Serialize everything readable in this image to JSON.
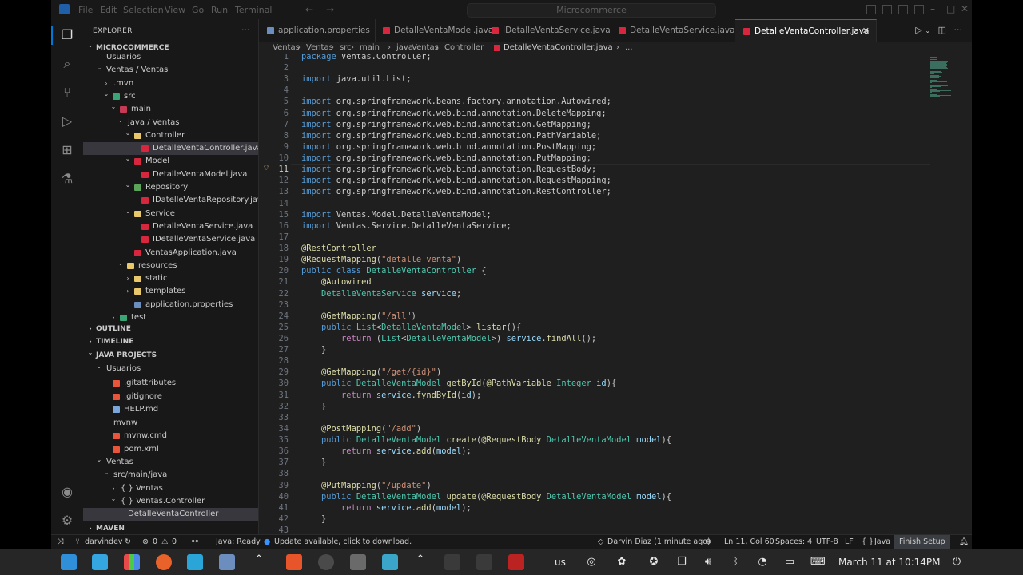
{
  "titlebar": {
    "menu": [
      "File",
      "Edit",
      "Selection",
      "View",
      "Go",
      "Run",
      "Terminal"
    ],
    "command_center": "Microcommerce"
  },
  "sidebar": {
    "title": "EXPLORER",
    "project_header": "MICROCOMMERCE",
    "tree": [
      {
        "label": "Usuarios",
        "indent": 1,
        "twisty": "",
        "icon": ""
      },
      {
        "label": "Ventas / Ventas",
        "indent": 1,
        "twisty": "v",
        "icon": ""
      },
      {
        "label": ".mvn",
        "indent": 2,
        "twisty": ">",
        "icon": ""
      },
      {
        "label": "src",
        "indent": 2,
        "twisty": "v",
        "icon": "#3aa675"
      },
      {
        "label": "main",
        "indent": 3,
        "twisty": "v",
        "icon": "#c73a55"
      },
      {
        "label": "java / Ventas",
        "indent": 4,
        "twisty": "v",
        "icon": ""
      },
      {
        "label": "Controller",
        "indent": 5,
        "twisty": "v",
        "icon": "#e8c86a"
      },
      {
        "label": "DetalleVentaController.java",
        "indent": 6,
        "twisty": "",
        "icon": "#d7263d",
        "selected": true
      },
      {
        "label": "Model",
        "indent": 5,
        "twisty": "v",
        "icon": "#d7263d"
      },
      {
        "label": "DetalleVentaModel.java",
        "indent": 6,
        "twisty": "",
        "icon": "#d7263d"
      },
      {
        "label": "Repository",
        "indent": 5,
        "twisty": "v",
        "icon": "#5aa55a"
      },
      {
        "label": "IDatelleVentaRepository.java",
        "indent": 6,
        "twisty": "",
        "icon": "#d7263d"
      },
      {
        "label": "Service",
        "indent": 5,
        "twisty": "v",
        "icon": "#e8c86a"
      },
      {
        "label": "DetalleVentaService.java",
        "indent": 6,
        "twisty": "",
        "icon": "#d7263d"
      },
      {
        "label": "IDetalleVentaService.java",
        "indent": 6,
        "twisty": "",
        "icon": "#d7263d"
      },
      {
        "label": "VentasApplication.java",
        "indent": 5,
        "twisty": "",
        "icon": "#d7263d"
      },
      {
        "label": "resources",
        "indent": 4,
        "twisty": "v",
        "icon": "#e8c86a"
      },
      {
        "label": "static",
        "indent": 5,
        "twisty": ">",
        "icon": "#e8c86a"
      },
      {
        "label": "templates",
        "indent": 5,
        "twisty": ">",
        "icon": "#e8c86a"
      },
      {
        "label": "application.properties",
        "indent": 5,
        "twisty": "",
        "icon": "#6c8ebf"
      },
      {
        "label": "test",
        "indent": 3,
        "twisty": ">",
        "icon": "#3aa675"
      }
    ],
    "sections": [
      "OUTLINE",
      "TIMELINE",
      "JAVA PROJECTS"
    ],
    "java_projects": [
      {
        "label": "Usuarios",
        "indent": 1,
        "twisty": "v",
        "icon": ""
      },
      {
        "label": ".gitattributes",
        "indent": 2,
        "twisty": "",
        "icon": "#e8553a"
      },
      {
        "label": ".gitignore",
        "indent": 2,
        "twisty": "",
        "icon": "#e8553a"
      },
      {
        "label": "HELP.md",
        "indent": 2,
        "twisty": "",
        "icon": "#7aa6da"
      },
      {
        "label": "mvnw",
        "indent": 2,
        "twisty": "",
        "icon": ""
      },
      {
        "label": "mvnw.cmd",
        "indent": 2,
        "twisty": "",
        "icon": "#e8553a"
      },
      {
        "label": "pom.xml",
        "indent": 2,
        "twisty": "",
        "icon": "#e8553a"
      },
      {
        "label": "Ventas",
        "indent": 1,
        "twisty": "v",
        "icon": ""
      },
      {
        "label": "src/main/java",
        "indent": 2,
        "twisty": "v",
        "icon": ""
      },
      {
        "label": "{ } Ventas",
        "indent": 3,
        "twisty": ">",
        "icon": ""
      },
      {
        "label": "{ } Ventas.Controller",
        "indent": 3,
        "twisty": "v",
        "icon": ""
      },
      {
        "label": "DetalleVentaController",
        "indent": 4,
        "twisty": "",
        "icon": "",
        "selected": true
      }
    ],
    "maven_header": "MAVEN"
  },
  "tabs": [
    {
      "label": "application.properties",
      "icon": "#6c8ebf",
      "active": false
    },
    {
      "label": "DetalleVentaModel.java",
      "icon": "#d7263d",
      "active": false
    },
    {
      "label": "IDetalleVentaService.java",
      "icon": "#d7263d",
      "active": false
    },
    {
      "label": "DetalleVentaService.java",
      "icon": "#d7263d",
      "active": false
    },
    {
      "label": "DetalleVentaController.java",
      "icon": "#d7263d",
      "active": true
    }
  ],
  "breadcrumb": [
    "Ventas",
    "Ventas",
    "src",
    "main",
    "java",
    "Ventas",
    "Controller",
    "DetalleVentaController.java",
    "..."
  ],
  "editor": {
    "current_line": 11,
    "lines": [
      {
        "n": 1,
        "tokens": [
          [
            "k",
            "package "
          ],
          [
            "p",
            "Ventas.Controller;"
          ]
        ]
      },
      {
        "n": 2,
        "tokens": []
      },
      {
        "n": 3,
        "tokens": [
          [
            "k",
            "import "
          ],
          [
            "p",
            "java.util.List;"
          ]
        ]
      },
      {
        "n": 4,
        "tokens": []
      },
      {
        "n": 5,
        "tokens": [
          [
            "k",
            "import "
          ],
          [
            "p",
            "org.springframework.beans.factory.annotation.Autowired;"
          ]
        ]
      },
      {
        "n": 6,
        "tokens": [
          [
            "k",
            "import "
          ],
          [
            "p",
            "org.springframework.web.bind.annotation.DeleteMapping;"
          ]
        ]
      },
      {
        "n": 7,
        "tokens": [
          [
            "k",
            "import "
          ],
          [
            "p",
            "org.springframework.web.bind.annotation.GetMapping;"
          ]
        ]
      },
      {
        "n": 8,
        "tokens": [
          [
            "k",
            "import "
          ],
          [
            "p",
            "org.springframework.web.bind.annotation.PathVariable;"
          ]
        ]
      },
      {
        "n": 9,
        "tokens": [
          [
            "k",
            "import "
          ],
          [
            "p",
            "org.springframework.web.bind.annotation.PostMapping;"
          ]
        ]
      },
      {
        "n": 10,
        "tokens": [
          [
            "k",
            "import "
          ],
          [
            "p",
            "org.springframework.web.bind.annotation.PutMapping;"
          ]
        ]
      },
      {
        "n": 11,
        "tokens": [
          [
            "k",
            "import "
          ],
          [
            "p",
            "org.springframework.web.bind.annotation.RequestBody;"
          ]
        ]
      },
      {
        "n": 12,
        "tokens": [
          [
            "k",
            "import "
          ],
          [
            "p",
            "org.springframework.web.bind.annotation.RequestMapping;"
          ]
        ]
      },
      {
        "n": 13,
        "tokens": [
          [
            "k",
            "import "
          ],
          [
            "p",
            "org.springframework.web.bind.annotation.RestController;"
          ]
        ]
      },
      {
        "n": 14,
        "tokens": []
      },
      {
        "n": 15,
        "tokens": [
          [
            "k",
            "import "
          ],
          [
            "p",
            "Ventas.Model.DetalleVentaModel;"
          ]
        ]
      },
      {
        "n": 16,
        "tokens": [
          [
            "k",
            "import "
          ],
          [
            "p",
            "Ventas.Service.DetalleVentaService;"
          ]
        ]
      },
      {
        "n": 17,
        "tokens": []
      },
      {
        "n": 18,
        "tokens": [
          [
            "a",
            "@RestController"
          ]
        ]
      },
      {
        "n": 19,
        "tokens": [
          [
            "a",
            "@RequestMapping"
          ],
          [
            "p",
            "("
          ],
          [
            "s",
            "\"detalle_venta\""
          ],
          [
            "p",
            ")"
          ]
        ]
      },
      {
        "n": 20,
        "tokens": [
          [
            "k",
            "public class "
          ],
          [
            "t",
            "DetalleVentaController"
          ],
          [
            "p",
            " {"
          ]
        ]
      },
      {
        "n": 21,
        "tokens": [
          [
            "p",
            "    "
          ],
          [
            "a",
            "@Autowired"
          ]
        ]
      },
      {
        "n": 22,
        "tokens": [
          [
            "p",
            "    "
          ],
          [
            "t",
            "DetalleVentaService"
          ],
          [
            "p",
            " "
          ],
          [
            "v",
            "service"
          ],
          [
            "p",
            ";"
          ]
        ]
      },
      {
        "n": 23,
        "tokens": []
      },
      {
        "n": 24,
        "tokens": [
          [
            "p",
            "    "
          ],
          [
            "a",
            "@GetMapping"
          ],
          [
            "p",
            "("
          ],
          [
            "s",
            "\"/all\""
          ],
          [
            "p",
            ")"
          ]
        ]
      },
      {
        "n": 25,
        "tokens": [
          [
            "p",
            "    "
          ],
          [
            "k",
            "public "
          ],
          [
            "t",
            "List"
          ],
          [
            "p",
            "<"
          ],
          [
            "t",
            "DetalleVentaModel"
          ],
          [
            "p",
            "> "
          ],
          [
            "f",
            "listar"
          ],
          [
            "p",
            "(){"
          ]
        ]
      },
      {
        "n": 26,
        "tokens": [
          [
            "p",
            "        "
          ],
          [
            "c2",
            "return "
          ],
          [
            "p",
            "("
          ],
          [
            "t",
            "List"
          ],
          [
            "p",
            "<"
          ],
          [
            "t",
            "DetalleVentaModel"
          ],
          [
            "p",
            ">) "
          ],
          [
            "v",
            "service"
          ],
          [
            "p",
            "."
          ],
          [
            "f",
            "findAll"
          ],
          [
            "p",
            "();"
          ]
        ]
      },
      {
        "n": 27,
        "tokens": [
          [
            "p",
            "    }"
          ]
        ]
      },
      {
        "n": 28,
        "tokens": []
      },
      {
        "n": 29,
        "tokens": [
          [
            "p",
            "    "
          ],
          [
            "a",
            "@GetMapping"
          ],
          [
            "p",
            "("
          ],
          [
            "s",
            "\"/get/{id}\""
          ],
          [
            "p",
            ")"
          ]
        ]
      },
      {
        "n": 30,
        "tokens": [
          [
            "p",
            "    "
          ],
          [
            "k",
            "public "
          ],
          [
            "t",
            "DetalleVentaModel"
          ],
          [
            "p",
            " "
          ],
          [
            "f",
            "getById"
          ],
          [
            "p",
            "("
          ],
          [
            "a",
            "@PathVariable"
          ],
          [
            "p",
            " "
          ],
          [
            "t",
            "Integer"
          ],
          [
            "p",
            " "
          ],
          [
            "v",
            "id"
          ],
          [
            "p",
            "){"
          ]
        ]
      },
      {
        "n": 31,
        "tokens": [
          [
            "p",
            "        "
          ],
          [
            "c2",
            "return "
          ],
          [
            "v",
            "service"
          ],
          [
            "p",
            "."
          ],
          [
            "f",
            "fyndById"
          ],
          [
            "p",
            "("
          ],
          [
            "v",
            "id"
          ],
          [
            "p",
            ");"
          ]
        ]
      },
      {
        "n": 32,
        "tokens": [
          [
            "p",
            "    }"
          ]
        ]
      },
      {
        "n": 33,
        "tokens": []
      },
      {
        "n": 34,
        "tokens": [
          [
            "p",
            "    "
          ],
          [
            "a",
            "@PostMapping"
          ],
          [
            "p",
            "("
          ],
          [
            "s",
            "\"/add\""
          ],
          [
            "p",
            ")"
          ]
        ]
      },
      {
        "n": 35,
        "tokens": [
          [
            "p",
            "    "
          ],
          [
            "k",
            "public "
          ],
          [
            "t",
            "DetalleVentaModel"
          ],
          [
            "p",
            " "
          ],
          [
            "f",
            "create"
          ],
          [
            "p",
            "("
          ],
          [
            "a",
            "@RequestBody"
          ],
          [
            "p",
            " "
          ],
          [
            "t",
            "DetalleVentaModel"
          ],
          [
            "p",
            " "
          ],
          [
            "v",
            "model"
          ],
          [
            "p",
            "){"
          ]
        ]
      },
      {
        "n": 36,
        "tokens": [
          [
            "p",
            "        "
          ],
          [
            "c2",
            "return "
          ],
          [
            "v",
            "service"
          ],
          [
            "p",
            "."
          ],
          [
            "f",
            "add"
          ],
          [
            "p",
            "("
          ],
          [
            "v",
            "model"
          ],
          [
            "p",
            ");"
          ]
        ]
      },
      {
        "n": 37,
        "tokens": [
          [
            "p",
            "    }"
          ]
        ]
      },
      {
        "n": 38,
        "tokens": []
      },
      {
        "n": 39,
        "tokens": [
          [
            "p",
            "    "
          ],
          [
            "a",
            "@PutMapping"
          ],
          [
            "p",
            "("
          ],
          [
            "s",
            "\"/update\""
          ],
          [
            "p",
            ")"
          ]
        ]
      },
      {
        "n": 40,
        "tokens": [
          [
            "p",
            "    "
          ],
          [
            "k",
            "public "
          ],
          [
            "t",
            "DetalleVentaModel"
          ],
          [
            "p",
            " "
          ],
          [
            "f",
            "update"
          ],
          [
            "p",
            "("
          ],
          [
            "a",
            "@RequestBody"
          ],
          [
            "p",
            " "
          ],
          [
            "t",
            "DetalleVentaModel"
          ],
          [
            "p",
            " "
          ],
          [
            "v",
            "model"
          ],
          [
            "p",
            "){"
          ]
        ]
      },
      {
        "n": 41,
        "tokens": [
          [
            "p",
            "        "
          ],
          [
            "c2",
            "return "
          ],
          [
            "v",
            "service"
          ],
          [
            "p",
            "."
          ],
          [
            "f",
            "add"
          ],
          [
            "p",
            "("
          ],
          [
            "v",
            "model"
          ],
          [
            "p",
            ");"
          ]
        ]
      },
      {
        "n": 42,
        "tokens": [
          [
            "p",
            "    }"
          ]
        ]
      },
      {
        "n": 43,
        "tokens": []
      }
    ]
  },
  "statusbar": {
    "branch": "darvindev",
    "problems": "0",
    "warnings": "0",
    "java_status": "Java: Ready",
    "update": "Update available, click to download.",
    "blame": "Darvin Diaz (1 minute ago)",
    "position": "Ln 11, Col 60",
    "spaces": "Spaces: 4",
    "encoding": "UTF-8",
    "eol": "LF",
    "language": "Java",
    "finish_setup": "Finish Setup"
  },
  "taskbar": {
    "keyboard": "us",
    "datetime": "March 11 at 10:14PM"
  }
}
